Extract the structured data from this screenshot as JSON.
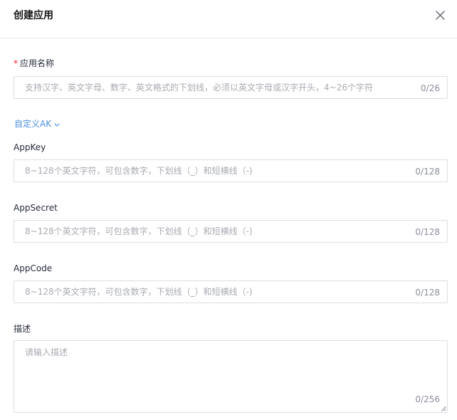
{
  "dialog": {
    "title": "创建应用"
  },
  "form": {
    "app_name": {
      "required_mark": "*",
      "label": "应用名称",
      "placeholder": "支持汉字、英文字母、数字、英文格式的下划线，必须以英文字母或汉字开头，4~26个字符",
      "counter": "0/26"
    },
    "custom_ak_toggle": "自定义AK",
    "app_key": {
      "label": "AppKey",
      "placeholder": "8~128个英文字符，可包含数字，下划线（_）和短横线（-)",
      "counter": "0/128"
    },
    "app_secret": {
      "label": "AppSecret",
      "placeholder": "8~128个英文字符，可包含数字，下划线（_）和短横线（-)",
      "counter": "0/128"
    },
    "app_code": {
      "label": "AppCode",
      "placeholder": "8~128个英文字符，可包含数字，下划线（_）和短横线（-)",
      "counter": "0/128"
    },
    "description": {
      "label": "描述",
      "placeholder": "请输入描述",
      "counter": "0/256"
    }
  },
  "icons": {
    "close": "close-icon",
    "chevron": "chevron-down-icon",
    "resize": "resize-grip-icon"
  },
  "colors": {
    "link": "#4a90e2",
    "required": "#f5222d",
    "border": "#dcdfe6"
  }
}
